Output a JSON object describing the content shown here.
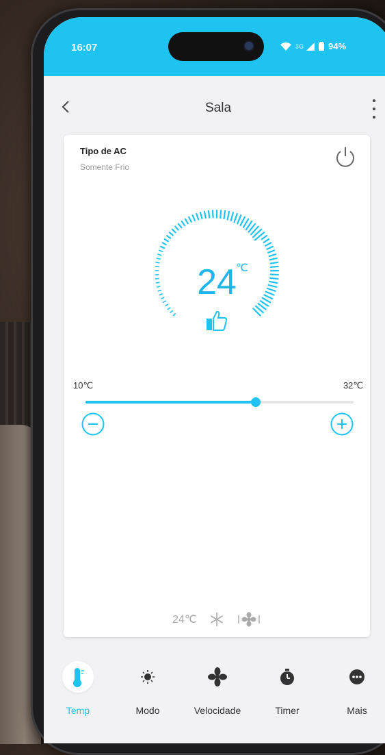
{
  "status_bar": {
    "time": "16:07",
    "network": "3G",
    "battery": "94%"
  },
  "header": {
    "title": "Sala"
  },
  "card": {
    "ac_type_label": "Tipo de AC",
    "ac_type_value": "Somente Frio",
    "temperature": "24",
    "temperature_unit": "℃",
    "min_label": "10℃",
    "max_label": "32℃",
    "slider_min": 10,
    "slider_max": 32,
    "slider_value": 24
  },
  "summary": {
    "temperature": "24℃"
  },
  "nav": {
    "items": [
      {
        "label": "Temp",
        "icon": "thermometer-icon",
        "active": true
      },
      {
        "label": "Modo",
        "icon": "mode-icon",
        "active": false
      },
      {
        "label": "Velocidade",
        "icon": "fan-icon",
        "active": false
      },
      {
        "label": "Timer",
        "icon": "timer-icon",
        "active": false
      },
      {
        "label": "Mais",
        "icon": "more-icon",
        "active": false
      }
    ]
  },
  "colors": {
    "accent": "#1ec3f0",
    "status_bar": "#1ec3f0"
  }
}
